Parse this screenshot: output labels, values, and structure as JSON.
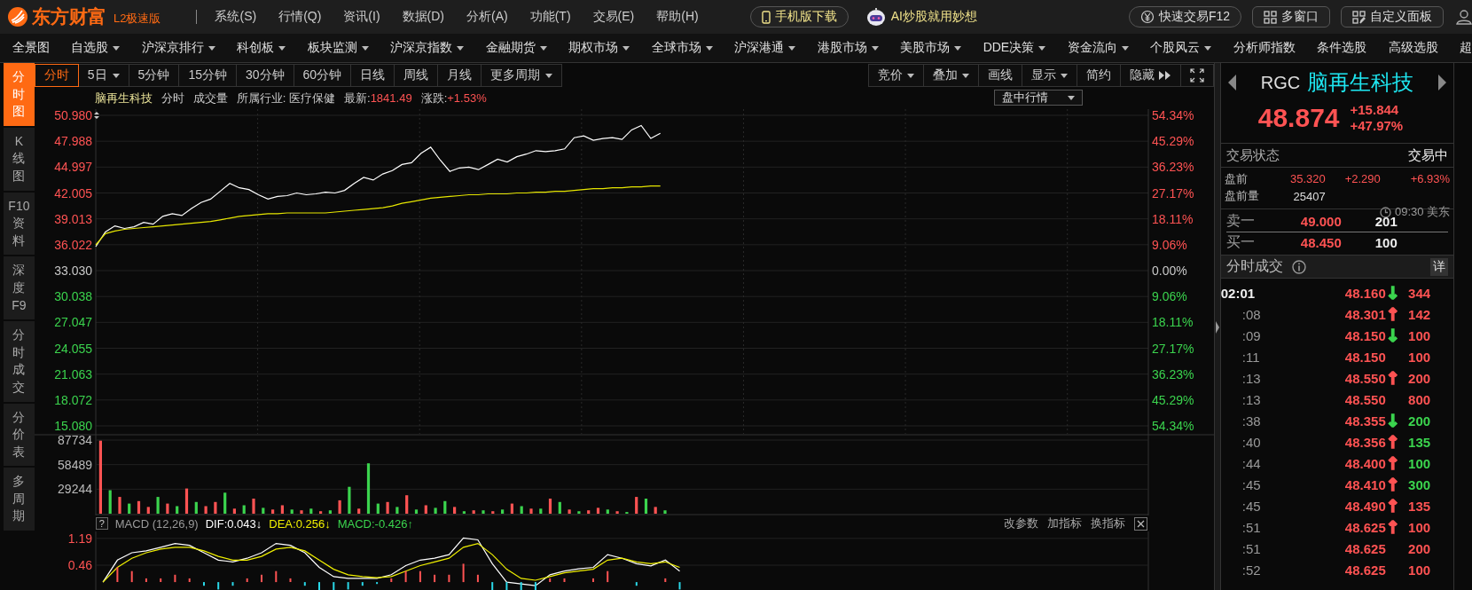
{
  "app": {
    "brand": "东方财富",
    "edition": "L2极速版"
  },
  "menu": [
    "系统(S)",
    "行情(Q)",
    "资讯(I)",
    "数据(D)",
    "分析(A)",
    "功能(T)",
    "交易(E)",
    "帮助(H)"
  ],
  "top_buttons": [
    {
      "kind": "phone",
      "label": "手机版下载"
    },
    {
      "kind": "ai",
      "label": "AI炒股就用妙想"
    },
    {
      "kind": "trade",
      "label": "快速交易F12"
    },
    {
      "kind": "windows",
      "label": "多窗口"
    },
    {
      "kind": "panel",
      "label": "自定义面板"
    }
  ],
  "nav": [
    {
      "label": "全景图",
      "dropdown": false
    },
    {
      "label": "自选股",
      "dropdown": true
    },
    {
      "label": "沪深京排行",
      "dropdown": true
    },
    {
      "label": "科创板",
      "dropdown": true
    },
    {
      "label": "板块监测",
      "dropdown": true
    },
    {
      "label": "沪深京指数",
      "dropdown": true
    },
    {
      "label": "金融期货",
      "dropdown": true
    },
    {
      "label": "期权市场",
      "dropdown": true
    },
    {
      "label": "全球市场",
      "dropdown": true
    },
    {
      "label": "沪深港通",
      "dropdown": true
    },
    {
      "label": "港股市场",
      "dropdown": true
    },
    {
      "label": "美股市场",
      "dropdown": true
    },
    {
      "label": "DDE决策",
      "dropdown": true
    },
    {
      "label": "资金流向",
      "dropdown": true
    },
    {
      "label": "个股风云",
      "dropdown": true
    },
    {
      "label": "分析师指数",
      "dropdown": false
    },
    {
      "label": "条件选股",
      "dropdown": false
    },
    {
      "label": "高级选股",
      "dropdown": false
    },
    {
      "label": "超",
      "dropdown": false
    }
  ],
  "side_tabs": [
    {
      "label": "分时图",
      "selected": true
    },
    {
      "label": "K线图",
      "selected": false
    },
    {
      "label": "F10资料",
      "selected": false
    },
    {
      "label": "深度F9",
      "selected": false
    },
    {
      "label": "分时成交",
      "selected": false
    },
    {
      "label": "分价表",
      "selected": false
    },
    {
      "label": "多周期",
      "selected": false
    }
  ],
  "period_tabs": [
    {
      "label": "分时",
      "selected": true,
      "dropdown": false
    },
    {
      "label": "5日",
      "selected": false,
      "dropdown": true
    },
    {
      "label": "5分钟",
      "selected": false,
      "dropdown": false
    },
    {
      "label": "15分钟",
      "selected": false,
      "dropdown": false
    },
    {
      "label": "30分钟",
      "selected": false,
      "dropdown": false
    },
    {
      "label": "60分钟",
      "selected": false,
      "dropdown": false
    },
    {
      "label": "日线",
      "selected": false,
      "dropdown": false
    },
    {
      "label": "周线",
      "selected": false,
      "dropdown": false
    },
    {
      "label": "月线",
      "selected": false,
      "dropdown": false
    },
    {
      "label": "更多周期",
      "selected": false,
      "dropdown": true
    }
  ],
  "tools": [
    {
      "label": "竞价",
      "kind": "dropdown"
    },
    {
      "label": "叠加",
      "kind": "dropdown"
    },
    {
      "label": "画线",
      "kind": "plain"
    },
    {
      "label": "显示",
      "kind": "dropdown"
    },
    {
      "label": "简约",
      "kind": "plain"
    },
    {
      "label": "隐藏",
      "kind": "collapse"
    }
  ],
  "info": {
    "name": "脑再生科技",
    "items": [
      "分时",
      "成交量",
      "所属行业: 医疗保健"
    ],
    "latest_label": "最新:",
    "latest": "1841.49",
    "change_label": "涨跌:",
    "change": "+1.53%"
  },
  "mode_select": {
    "value": "盘中行情"
  },
  "price_chart": {
    "percent_ticks": [
      "54.34%",
      "45.29%",
      "36.23%",
      "27.17%",
      "18.11%",
      "9.06%",
      "0.00%",
      "9.06%",
      "18.11%",
      "27.17%",
      "36.23%",
      "45.29%",
      "54.34%"
    ],
    "chart_data": {
      "type": "line",
      "ylim": [
        15.08,
        50.98
      ],
      "grid": true,
      "yticks": [
        {
          "value": 50.98,
          "label": "50.980"
        },
        {
          "value": 47.988,
          "label": "47.988"
        },
        {
          "value": 44.997,
          "label": "44.997"
        },
        {
          "value": 42.005,
          "label": "42.005"
        },
        {
          "value": 39.013,
          "label": "39.013"
        },
        {
          "value": 36.022,
          "label": "36.022"
        },
        {
          "value": 33.03,
          "label": "33.030"
        },
        {
          "value": 30.038,
          "label": "30.038"
        },
        {
          "value": 27.047,
          "label": "27.047"
        },
        {
          "value": 24.055,
          "label": "24.055"
        },
        {
          "value": 21.063,
          "label": "21.063"
        },
        {
          "value": 18.072,
          "label": "18.072"
        },
        {
          "value": 15.08,
          "label": "15.080"
        }
      ],
      "series": [
        {
          "color": "#ffffff",
          "values": [
            35.8,
            37.5,
            38.2,
            37.9,
            38.1,
            38.6,
            38.4,
            39.3,
            39.6,
            39.4,
            40.2,
            40.9,
            41.3,
            42.2,
            43.1,
            42.6,
            42.4,
            41.8,
            41.3,
            41.6,
            41.7,
            42.0,
            41.8,
            41.9,
            42.1,
            42.0,
            42.3,
            43.1,
            43.8,
            43.5,
            44.2,
            44.6,
            45.3,
            45.5,
            46.6,
            47.3,
            45.8,
            44.5,
            44.9,
            45.0,
            44.7,
            45.3,
            45.9,
            45.6,
            46.2,
            46.5,
            46.9,
            46.8,
            46.9,
            47.1,
            48.4,
            48.6,
            48.1,
            48.3,
            48.4,
            48.2,
            49.3,
            49.8,
            48.3,
            48.9
          ]
        },
        {
          "color": "#e6e600",
          "values": [
            36.0,
            37.3,
            37.6,
            37.8,
            37.9,
            38.0,
            38.1,
            38.2,
            38.3,
            38.4,
            38.5,
            38.6,
            38.7,
            38.9,
            39.1,
            39.3,
            39.4,
            39.5,
            39.6,
            39.6,
            39.7,
            39.7,
            39.7,
            39.7,
            39.7,
            39.8,
            39.9,
            40.0,
            40.1,
            40.2,
            40.3,
            40.5,
            40.8,
            41.0,
            41.2,
            41.4,
            41.5,
            41.6,
            41.7,
            41.8,
            41.8,
            41.9,
            41.9,
            41.9,
            42.0,
            42.0,
            42.1,
            42.1,
            42.2,
            42.2,
            42.3,
            42.4,
            42.5,
            42.5,
            42.6,
            42.6,
            42.7,
            42.7,
            42.8,
            42.8
          ]
        }
      ]
    }
  },
  "volume_chart": {
    "chart_data": {
      "type": "bar",
      "ylim": [
        0,
        87734
      ],
      "grid": true,
      "yticks": [
        {
          "value": 87734,
          "label": "87734"
        },
        {
          "value": 58489,
          "label": "58489"
        },
        {
          "value": 29244,
          "label": "29244"
        }
      ],
      "series": [
        {
          "color": "#ff5353",
          "values": [
            87000,
            null,
            20000,
            null,
            15000,
            8000,
            null,
            12000,
            null,
            30000,
            null,
            9000,
            14000,
            null,
            6000,
            null,
            18000,
            null,
            5000,
            10000,
            null,
            4000,
            null,
            3000,
            null,
            16000,
            null,
            6000,
            null,
            null,
            14000,
            null,
            22000,
            null,
            10000,
            null,
            null,
            8000,
            null,
            4000,
            null,
            3000,
            null,
            12000,
            null,
            6000,
            null,
            18000,
            null,
            5000,
            null,
            4000,
            7000,
            null,
            3000,
            null,
            20000,
            null,
            8000,
            null
          ]
        },
        {
          "color": "#3bd44e",
          "values": [
            null,
            28000,
            null,
            12000,
            null,
            null,
            20000,
            null,
            9000,
            null,
            14000,
            null,
            null,
            25000,
            null,
            10000,
            null,
            7000,
            null,
            null,
            5000,
            null,
            6000,
            null,
            4000,
            null,
            32000,
            null,
            60000,
            12000,
            null,
            8000,
            null,
            5000,
            null,
            7000,
            15000,
            null,
            3000,
            null,
            4000,
            null,
            5000,
            null,
            9000,
            null,
            6000,
            null,
            14000,
            null,
            3000,
            null,
            null,
            5000,
            null,
            2000,
            null,
            18000,
            null,
            4000
          ]
        }
      ]
    }
  },
  "macd": {
    "help": "?",
    "legend": [
      {
        "label": "MACD (12,26,9)",
        "color": "#9a9a9a"
      },
      {
        "label": "DIF:0.043↓",
        "color": "#ffffff"
      },
      {
        "label": "DEA:0.256↓",
        "color": "#f0f000"
      },
      {
        "label": "MACD:-0.426↑",
        "color": "#3bd44e"
      }
    ],
    "actions": [
      "改参数",
      "加指标",
      "换指标"
    ],
    "chart_data": {
      "type": "line",
      "ylim": [
        -0.24,
        1.38
      ],
      "grid": true,
      "yticks": [
        {
          "value": 1.19,
          "label": "1.19"
        },
        {
          "value": 0.46,
          "label": "0.46"
        }
      ],
      "series": [
        {
          "color": "#ffffff",
          "values": [
            0.0,
            0.6,
            0.8,
            0.85,
            0.95,
            1.05,
            1.0,
            0.8,
            0.6,
            0.55,
            0.65,
            0.8,
            1.05,
            1.0,
            0.8,
            0.4,
            0.15,
            0.1,
            0.1,
            0.1,
            0.2,
            0.45,
            0.6,
            0.65,
            0.75,
            1.2,
            1.15,
            0.5,
            0.0,
            -0.05,
            -0.1,
            0.2,
            0.3,
            0.36,
            0.4,
            0.75,
            0.65,
            0.5,
            0.44,
            0.6,
            0.3
          ]
        },
        {
          "color": "#f0f000",
          "values": [
            0.0,
            0.4,
            0.65,
            0.8,
            0.9,
            0.95,
            0.95,
            0.85,
            0.7,
            0.6,
            0.6,
            0.7,
            0.9,
            0.95,
            0.85,
            0.6,
            0.35,
            0.2,
            0.15,
            0.12,
            0.15,
            0.3,
            0.45,
            0.55,
            0.65,
            0.95,
            1.05,
            0.75,
            0.35,
            0.1,
            0.05,
            0.15,
            0.25,
            0.3,
            0.35,
            0.6,
            0.65,
            0.55,
            0.5,
            0.55,
            0.4
          ]
        },
        {
          "type": "bar",
          "color": "#ff5353",
          "values": [
            null,
            0.4,
            0.3,
            0.1,
            0.1,
            0.2,
            0.1,
            null,
            null,
            null,
            0.1,
            0.2,
            0.3,
            0.1,
            null,
            null,
            null,
            null,
            null,
            null,
            0.1,
            0.3,
            0.3,
            0.2,
            0.2,
            0.5,
            0.2,
            null,
            null,
            null,
            null,
            0.1,
            0.1,
            null,
            0.1,
            0.3,
            null,
            null,
            null,
            0.1,
            null
          ]
        },
        {
          "type": "bar",
          "color": "#2ad8e8",
          "values": [
            null,
            null,
            null,
            null,
            null,
            null,
            null,
            -0.1,
            -0.2,
            -0.1,
            null,
            null,
            null,
            null,
            -0.1,
            -0.22,
            -0.22,
            -0.2,
            -0.1,
            -0.05,
            null,
            null,
            null,
            null,
            null,
            null,
            null,
            -0.22,
            -0.22,
            -0.22,
            -0.22,
            null,
            null,
            null,
            null,
            null,
            null,
            -0.1,
            null,
            null,
            -0.2
          ]
        }
      ]
    }
  },
  "quote": {
    "symbol": "RGC",
    "name": "脑再生科技",
    "price": "48.874",
    "change": "+15.844",
    "change_pct": "+47.97%",
    "status_label": "交易状态",
    "status": "交易中",
    "pre_label": "盘前",
    "pre_price": "35.320",
    "pre_change": "+2.290",
    "pre_pct": "+6.93%",
    "pre_vol_label": "盘前量",
    "pre_vol": "25407",
    "pre_time": "09:30 美东",
    "book": [
      {
        "label": "卖一",
        "price": "49.000",
        "volume": "201"
      },
      {
        "label": "买一",
        "price": "48.450",
        "volume": "100"
      }
    ],
    "trades_title": "分时成交",
    "detail": "详",
    "trades": [
      {
        "time": "02:01",
        "kind": "minute",
        "price": "48.160",
        "arrow": {
          "text": "↓",
          "color": "#3bd44e"
        },
        "volume": "344",
        "color": "#ff5353"
      },
      {
        "time": ":08",
        "kind": "second",
        "price": "48.301",
        "arrow": {
          "text": "↑",
          "color": "#ff5353"
        },
        "volume": "142",
        "color": "#ff5353"
      },
      {
        "time": ":09",
        "kind": "second",
        "price": "48.150",
        "arrow": {
          "text": "↓",
          "color": "#3bd44e"
        },
        "volume": "100",
        "color": "#ff5353"
      },
      {
        "time": ":11",
        "kind": "second",
        "price": "48.150",
        "volume": "100",
        "color": "#ff5353"
      },
      {
        "time": ":13",
        "kind": "second",
        "price": "48.550",
        "arrow": {
          "text": "↑",
          "color": "#ff5353"
        },
        "volume": "200",
        "color": "#ff5353"
      },
      {
        "time": ":13",
        "kind": "second",
        "price": "48.550",
        "volume": "800",
        "color": "#ff5353"
      },
      {
        "time": ":38",
        "kind": "second",
        "price": "48.355",
        "arrow": {
          "text": "↓",
          "color": "#3bd44e"
        },
        "volume": "200",
        "color": "#3bd44e"
      },
      {
        "time": ":40",
        "kind": "second",
        "price": "48.356",
        "arrow": {
          "text": "↑",
          "color": "#ff5353"
        },
        "volume": "135",
        "color": "#3bd44e"
      },
      {
        "time": ":44",
        "kind": "second",
        "price": "48.400",
        "arrow": {
          "text": "↑",
          "color": "#ff5353"
        },
        "volume": "100",
        "color": "#3bd44e"
      },
      {
        "time": ":45",
        "kind": "second",
        "price": "48.410",
        "arrow": {
          "text": "↑",
          "color": "#ff5353"
        },
        "volume": "300",
        "color": "#3bd44e"
      },
      {
        "time": ":45",
        "kind": "second",
        "price": "48.490",
        "arrow": {
          "text": "↑",
          "color": "#ff5353"
        },
        "volume": "135",
        "color": "#ff5353"
      },
      {
        "time": ":51",
        "kind": "second",
        "price": "48.625",
        "arrow": {
          "text": "↑",
          "color": "#ff5353"
        },
        "volume": "100",
        "color": "#ff5353"
      },
      {
        "time": ":51",
        "kind": "second",
        "price": "48.625",
        "volume": "200",
        "color": "#ff5353"
      },
      {
        "time": ":52",
        "kind": "second",
        "price": "48.625",
        "volume": "100",
        "color": "#ff5353"
      }
    ]
  }
}
